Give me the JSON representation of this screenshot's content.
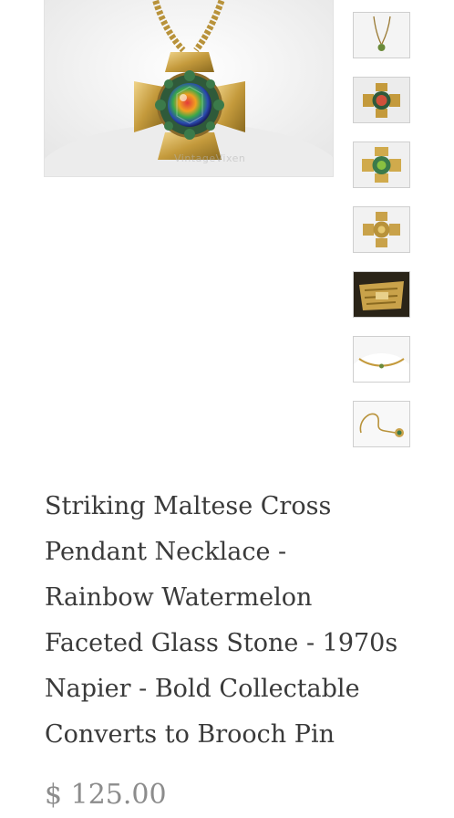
{
  "product": {
    "title_lines": [
      "Striking Maltese Cross",
      "Pendant Necklace -",
      "Rainbow Watermelon",
      "Faceted Glass Stone - 1970s",
      "Napier - Bold Collectable",
      "Converts to Brooch Pin"
    ],
    "price": "$ 125.00"
  },
  "gallery": {
    "main_image": "maltese-cross-pendant-photo",
    "watermark": "VintageVixen",
    "thumbnails": [
      {
        "name": "thumb-full-necklace"
      },
      {
        "name": "thumb-pendant-closeup"
      },
      {
        "name": "thumb-pendant-front"
      },
      {
        "name": "thumb-pendant-back"
      },
      {
        "name": "thumb-clasp-detail"
      },
      {
        "name": "thumb-necklace-on-bust"
      },
      {
        "name": "thumb-chain-coiled"
      }
    ]
  },
  "colors": {
    "title": "#3a3a3a",
    "price": "#8c8c8c",
    "gold": "#c9a24a",
    "border": "#cfcfcf"
  }
}
